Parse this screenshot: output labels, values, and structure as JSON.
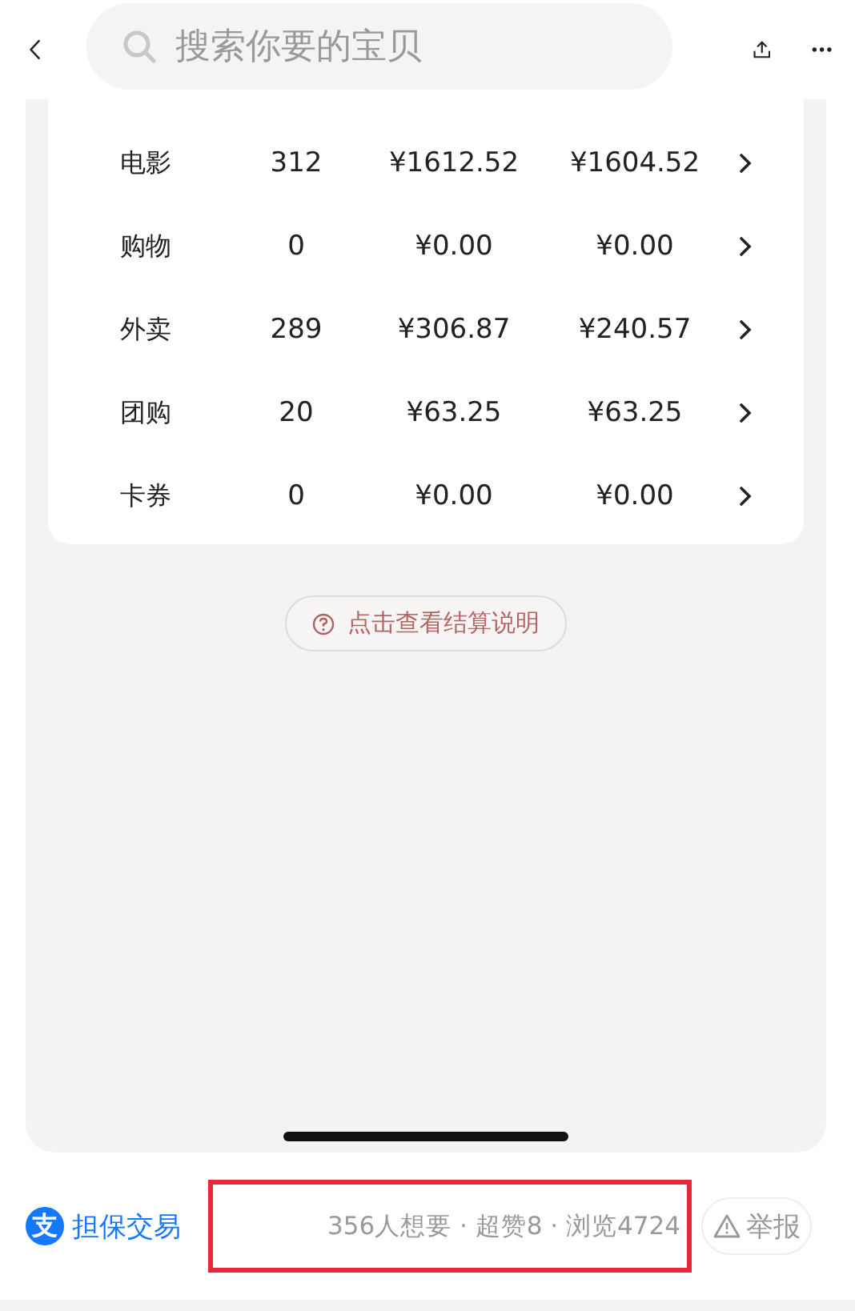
{
  "top_bar": {
    "search": {
      "placeholder": "搜索你要的宝贝"
    }
  },
  "table": {
    "rows": [
      {
        "name": "电影",
        "count": "312",
        "amount_1": "¥1612.52",
        "amount_2": "¥1604.52"
      },
      {
        "name": "购物",
        "count": "0",
        "amount_1": "¥0.00",
        "amount_2": "¥0.00"
      },
      {
        "name": "外卖",
        "count": "289",
        "amount_1": "¥306.87",
        "amount_2": "¥240.57"
      },
      {
        "name": "团购",
        "count": "20",
        "amount_1": "¥63.25",
        "amount_2": "¥63.25"
      },
      {
        "name": "卡券",
        "count": "0",
        "amount_1": "¥0.00",
        "amount_2": "¥0.00"
      }
    ]
  },
  "help_button": {
    "label": "点击查看结算说明"
  },
  "footer": {
    "badge": {
      "logo": "支",
      "label": "担保交易"
    },
    "stats": "356人想要 · 超赞8 · 浏览4724",
    "report": "举报"
  }
}
